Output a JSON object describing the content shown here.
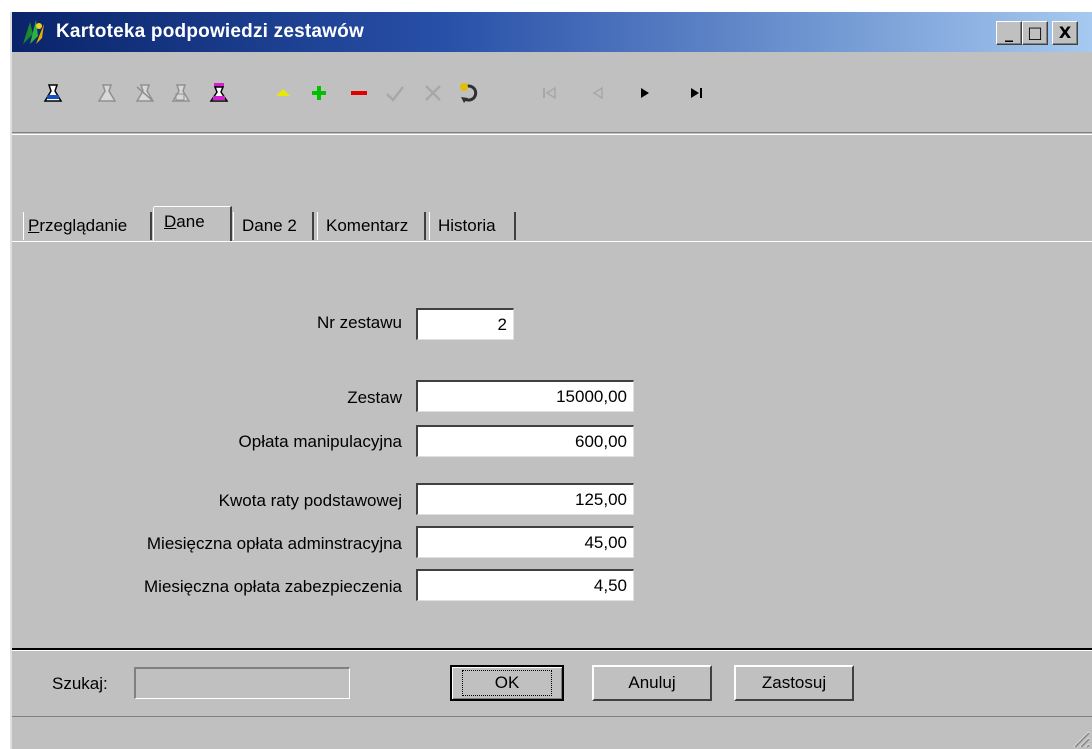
{
  "window": {
    "title": "Kartoteka podpowiedzi zestawów",
    "controls": {
      "minimize": "_",
      "maximize": "□",
      "close": "X"
    }
  },
  "toolbar": {
    "icons": [
      "first-record-icon",
      "print-icon",
      "print-preview-icon",
      "export-icon",
      "report-icon",
      "up-arrow-icon",
      "add-icon",
      "remove-icon",
      "confirm-icon",
      "cancel-icon",
      "refresh-icon",
      "nav-first-icon",
      "nav-prev-icon",
      "nav-next-icon",
      "nav-last-icon"
    ],
    "colors": {
      "up": "#e8e800",
      "add": "#00c000",
      "remove": "#e00000",
      "refresh": "#e0c000"
    }
  },
  "tabs": [
    {
      "label": "Przeglądanie",
      "underline": "P",
      "rest": "rzeglądanie"
    },
    {
      "label": "Dane",
      "underline": "D",
      "rest": "ane",
      "active": true
    },
    {
      "label": "Dane 2"
    },
    {
      "label": "Komentarz"
    },
    {
      "label": "Historia"
    }
  ],
  "form": {
    "nr_zestawu": {
      "label": "Nr zestawu",
      "value": "2"
    },
    "zestaw": {
      "label": "Zestaw",
      "value": "15000,00"
    },
    "oplata_manipulacyjna": {
      "label": "Opłata manipulacyjna",
      "value": "600,00"
    },
    "kwota_raty": {
      "label": "Kwota raty podstawowej",
      "value": "125,00"
    },
    "oplata_administracyjna": {
      "label": "Miesięczna opłata adminstracyjna",
      "value": "45,00"
    },
    "oplata_zabezpieczenia": {
      "label": "Miesięczna opłata zabezpieczenia",
      "value": "4,50"
    }
  },
  "footer": {
    "search_label": "Szukaj:",
    "search_value": "",
    "ok": "OK",
    "cancel": "Anuluj",
    "apply": "Zastosuj"
  }
}
